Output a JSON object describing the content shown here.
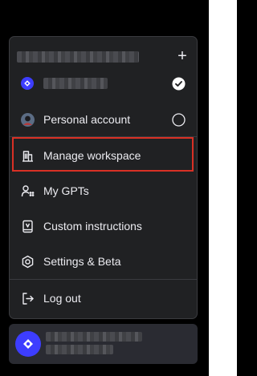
{
  "menu": {
    "add_label": "+",
    "items": {
      "personal_account": "Personal account",
      "manage_workspace": "Manage workspace",
      "my_gpts": "My GPTs",
      "custom_instructions": "Custom instructions",
      "settings_beta": "Settings & Beta",
      "log_out": "Log out"
    }
  },
  "colors": {
    "background": "#000000",
    "menu_bg": "#202123",
    "text": "#ececf1",
    "highlight": "#d93025",
    "workspace_avatar": "#3d3dff"
  },
  "icons": {
    "add": "plus-icon",
    "workspace_avatar": "diamond-avatar-icon",
    "selected": "check-circle-icon",
    "unselected": "radio-empty-icon",
    "manage_workspace": "building-icon",
    "my_gpts": "gpts-icon",
    "custom_instructions": "document-icon",
    "settings": "gear-icon",
    "log_out": "log-out-icon"
  }
}
